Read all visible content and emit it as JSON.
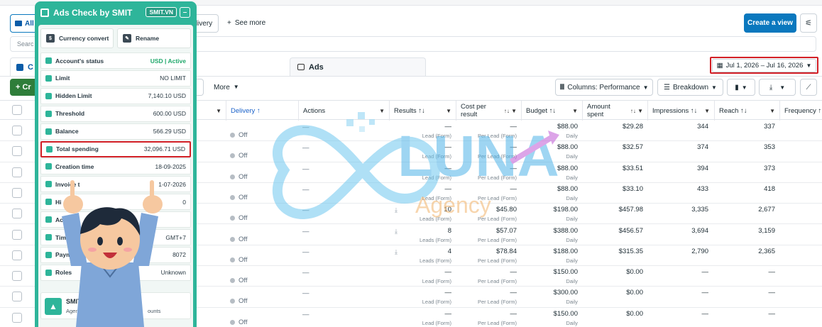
{
  "toolbar": {
    "all_label": "All",
    "delivery_label": "livery",
    "see_more": "See more",
    "create_view": "Create a view"
  },
  "search": {
    "placeholder": "Searc"
  },
  "tabs": {
    "campaigns_initial": "C",
    "ads": "Ads"
  },
  "date_range": "Jul 1, 2026 – Jul 16, 2026",
  "toolbar2": {
    "create_label": "+ Cr",
    "more": "More",
    "columns": "Columns: Performance",
    "breakdown": "Breakdown"
  },
  "columns": {
    "delivery": "Delivery ↑",
    "actions": "Actions",
    "results": "Results ↑↓",
    "cost_per_result": "Cost per result",
    "budget": "Budget ↑↓",
    "amount_spent": "Amount spent",
    "impressions": "Impressions ↑↓",
    "reach": "Reach ↑↓",
    "frequency": "Frequency ↑"
  },
  "rows": [
    {
      "delivery": "Off",
      "actions": "—",
      "results": "—",
      "results_sub": "Lead (Form)",
      "cpr": "—",
      "cpr_sub": "Per Lead (Form)",
      "budget": "$88.00",
      "budget_sub": "Daily",
      "spent": "$29.28",
      "impressions": "344",
      "reach": "337",
      "download": false
    },
    {
      "delivery": "Off",
      "actions": "—",
      "results": "—",
      "results_sub": "Lead (Form)",
      "cpr": "—",
      "cpr_sub": "Per Lead (Form)",
      "budget": "$88.00",
      "budget_sub": "Daily",
      "spent": "$32.57",
      "impressions": "374",
      "reach": "353",
      "download": false
    },
    {
      "delivery": "Off",
      "actions": "—",
      "results": "—",
      "results_sub": "Lead (Form)",
      "cpr": "—",
      "cpr_sub": "Per Lead (Form)",
      "budget": "$88.00",
      "budget_sub": "Daily",
      "spent": "$33.51",
      "impressions": "394",
      "reach": "373",
      "download": false
    },
    {
      "delivery": "Off",
      "actions": "—",
      "results": "—",
      "results_sub": "Lead (Form)",
      "cpr": "—",
      "cpr_sub": "Per Lead (Form)",
      "budget": "$88.00",
      "budget_sub": "Daily",
      "spent": "$33.10",
      "impressions": "433",
      "reach": "418",
      "download": false
    },
    {
      "delivery": "Off",
      "actions": "—",
      "results": "10",
      "results_sub": "Leads (Form)",
      "cpr": "$45.80",
      "cpr_sub": "Per Lead (Form)",
      "budget": "$198.00",
      "budget_sub": "Daily",
      "spent": "$457.98",
      "impressions": "3,335",
      "reach": "2,677",
      "download": true
    },
    {
      "delivery": "Off",
      "actions": "—",
      "results": "8",
      "results_sub": "Leads (Form)",
      "cpr": "$57.07",
      "cpr_sub": "Per Lead (Form)",
      "budget": "$388.00",
      "budget_sub": "Daily",
      "spent": "$456.57",
      "impressions": "3,694",
      "reach": "3,159",
      "download": true
    },
    {
      "delivery": "Off",
      "actions": "—",
      "results": "4",
      "results_sub": "Leads (Form)",
      "cpr": "$78.84",
      "cpr_sub": "Per Lead (Form)",
      "budget": "$188.00",
      "budget_sub": "Daily",
      "spent": "$315.35",
      "impressions": "2,790",
      "reach": "2,365",
      "download": true
    },
    {
      "delivery": "Off",
      "actions": "—",
      "results": "—",
      "results_sub": "Lead (Form)",
      "cpr": "—",
      "cpr_sub": "Per Lead (Form)",
      "budget": "$150.00",
      "budget_sub": "Daily",
      "spent": "$0.00",
      "impressions": "—",
      "reach": "—",
      "download": false
    },
    {
      "delivery": "Off",
      "actions": "—",
      "results": "—",
      "results_sub": "Lead (Form)",
      "cpr": "—",
      "cpr_sub": "Per Lead (Form)",
      "budget": "$300.00",
      "budget_sub": "Daily",
      "spent": "$0.00",
      "impressions": "—",
      "reach": "—",
      "download": false
    },
    {
      "delivery": "Off",
      "actions": "—",
      "results": "—",
      "results_sub": "Lead (Form)",
      "cpr": "—",
      "cpr_sub": "Per Lead (Form)",
      "budget": "$150.00",
      "budget_sub": "Daily",
      "spent": "$0.00",
      "impressions": "—",
      "reach": "—",
      "download": false
    }
  ],
  "panel": {
    "title": "Ads Check by SMIT",
    "badge": "SMIT.VN",
    "minimize": "–",
    "currency_convert": "Currency convert",
    "rename": "Rename",
    "items": [
      {
        "label": "Account's status",
        "value": "USD | Active",
        "green": true
      },
      {
        "label": "Limit",
        "value": "NO LIMIT"
      },
      {
        "label": "Hidden Limit",
        "value": "7,140.10 USD"
      },
      {
        "label": "Threshold",
        "value": "600.00 USD"
      },
      {
        "label": "Balance",
        "value": "566.29 USD"
      },
      {
        "label": "Total spending",
        "value": "32,096.71 USD",
        "highlight": true
      },
      {
        "label": "Creation time",
        "value": "18-09-2025"
      },
      {
        "label": "Invoice t",
        "value": "1-07-2026"
      },
      {
        "label": "Hi",
        "value": "0"
      },
      {
        "label": "Acco",
        "value": ""
      },
      {
        "label": "Timez",
        "value": "GMT+7"
      },
      {
        "label": "Paymen",
        "value": "8072"
      },
      {
        "label": "Roles",
        "value": "Unknown"
      }
    ],
    "agency_title": "SMIT Ag",
    "agency_sub": "Agency s",
    "agency_sub2": "ounts"
  },
  "watermark": {
    "brand": "LUNA",
    "sub": "Agency"
  },
  "colors": {
    "accent": "#0a78be",
    "panel": "#2eb59a",
    "highlight": "#d21f26"
  }
}
